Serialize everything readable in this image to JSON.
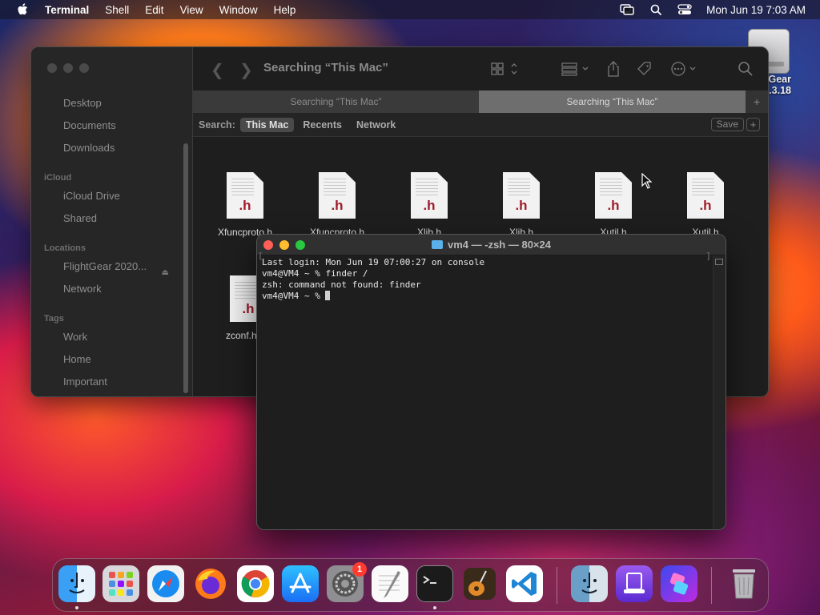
{
  "menubar": {
    "app_name": "Terminal",
    "items": [
      "Shell",
      "Edit",
      "View",
      "Window",
      "Help"
    ],
    "datetime": "Mon Jun 19  7:03 AM"
  },
  "desktop": {
    "volume_label_line1": "Gear",
    "volume_label_line2": ".3.18"
  },
  "finder": {
    "title": "Searching “This Mac”",
    "tabs": [
      "Searching “This Mac”",
      "Searching “This Mac”"
    ],
    "tab_add": "+",
    "search_label": "Search:",
    "scopes": [
      "This Mac",
      "Recents",
      "Network"
    ],
    "save_label": "Save",
    "add_label": "+",
    "sidebar": {
      "favorites": [
        "Desktop",
        "Documents",
        "Downloads"
      ],
      "icloud_header": "iCloud",
      "icloud": [
        "iCloud Drive",
        "Shared"
      ],
      "locations_header": "Locations",
      "locations": [
        "FlightGear 2020...",
        "Network"
      ],
      "tags_header": "Tags",
      "tags": [
        "Work",
        "Home",
        "Important"
      ]
    },
    "files": [
      {
        "label": "Xfuncproto.h",
        "ext": ".h"
      },
      {
        "label": "Xfuncproto.h",
        "ext": ".h"
      },
      {
        "label": "Xlib.h",
        "ext": ".h"
      },
      {
        "label": "Xlib.h",
        "ext": ".h"
      },
      {
        "label": "Xutil.h",
        "ext": ".h"
      },
      {
        "label": "Xutil.h",
        "ext": ".h"
      },
      {
        "label": "zconf.h",
        "ext": ".h"
      }
    ]
  },
  "terminal": {
    "title": "vm4 — -zsh — 80×24",
    "lines": [
      "Last login: Mon Jun 19 07:00:27 on console",
      "vm4@VM4 ~ % finder /",
      "zsh: command not found: finder",
      "vm4@VM4 ~ % "
    ]
  },
  "dock": {
    "apps": [
      "Finder",
      "Launchpad",
      "Safari",
      "Firefox",
      "Chrome",
      "App Store",
      "System Preferences",
      "TextEdit",
      "Terminal",
      "GarageBand",
      "Visual Studio Code",
      "Finder",
      "Simulator",
      "Shortcuts",
      "Trash"
    ],
    "settings_badge": "1"
  },
  "colors": {
    "terminal_bg": "#1e1e1e",
    "finder_bg": "#1e1e1e",
    "close": "#ff5f57",
    "minimize": "#febc2e",
    "zoom": "#28c840",
    "header_ext": "#a01a2a"
  }
}
